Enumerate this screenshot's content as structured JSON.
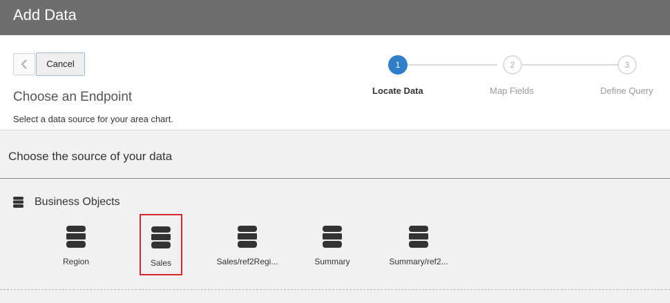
{
  "window": {
    "title": "Add Data"
  },
  "toolbar": {
    "cancel_label": "Cancel"
  },
  "wizard": {
    "heading": "Choose an Endpoint",
    "subtitle": "Select a data source for your area chart.",
    "steps": [
      {
        "number": "1",
        "label": "Locate Data",
        "state": "active"
      },
      {
        "number": "2",
        "label": "Map Fields",
        "state": "idle"
      },
      {
        "number": "3",
        "label": "Define Query",
        "state": "idle"
      }
    ]
  },
  "main": {
    "section_title": "Choose the source of your data",
    "group": {
      "label": "Business Objects",
      "icon": "database-icon",
      "items": [
        {
          "label": "Region",
          "icon": "database-icon",
          "selected": false
        },
        {
          "label": "Sales",
          "icon": "database-icon",
          "selected": true
        },
        {
          "label": "Sales/ref2Regi...",
          "icon": "database-icon",
          "selected": false
        },
        {
          "label": "Summary",
          "icon": "database-icon",
          "selected": false
        },
        {
          "label": "Summary/ref2...",
          "icon": "database-icon",
          "selected": false
        }
      ]
    }
  },
  "colors": {
    "title_bar": "#6e6e6e",
    "accent": "#2f7fc8",
    "selection": "#d9262c"
  }
}
